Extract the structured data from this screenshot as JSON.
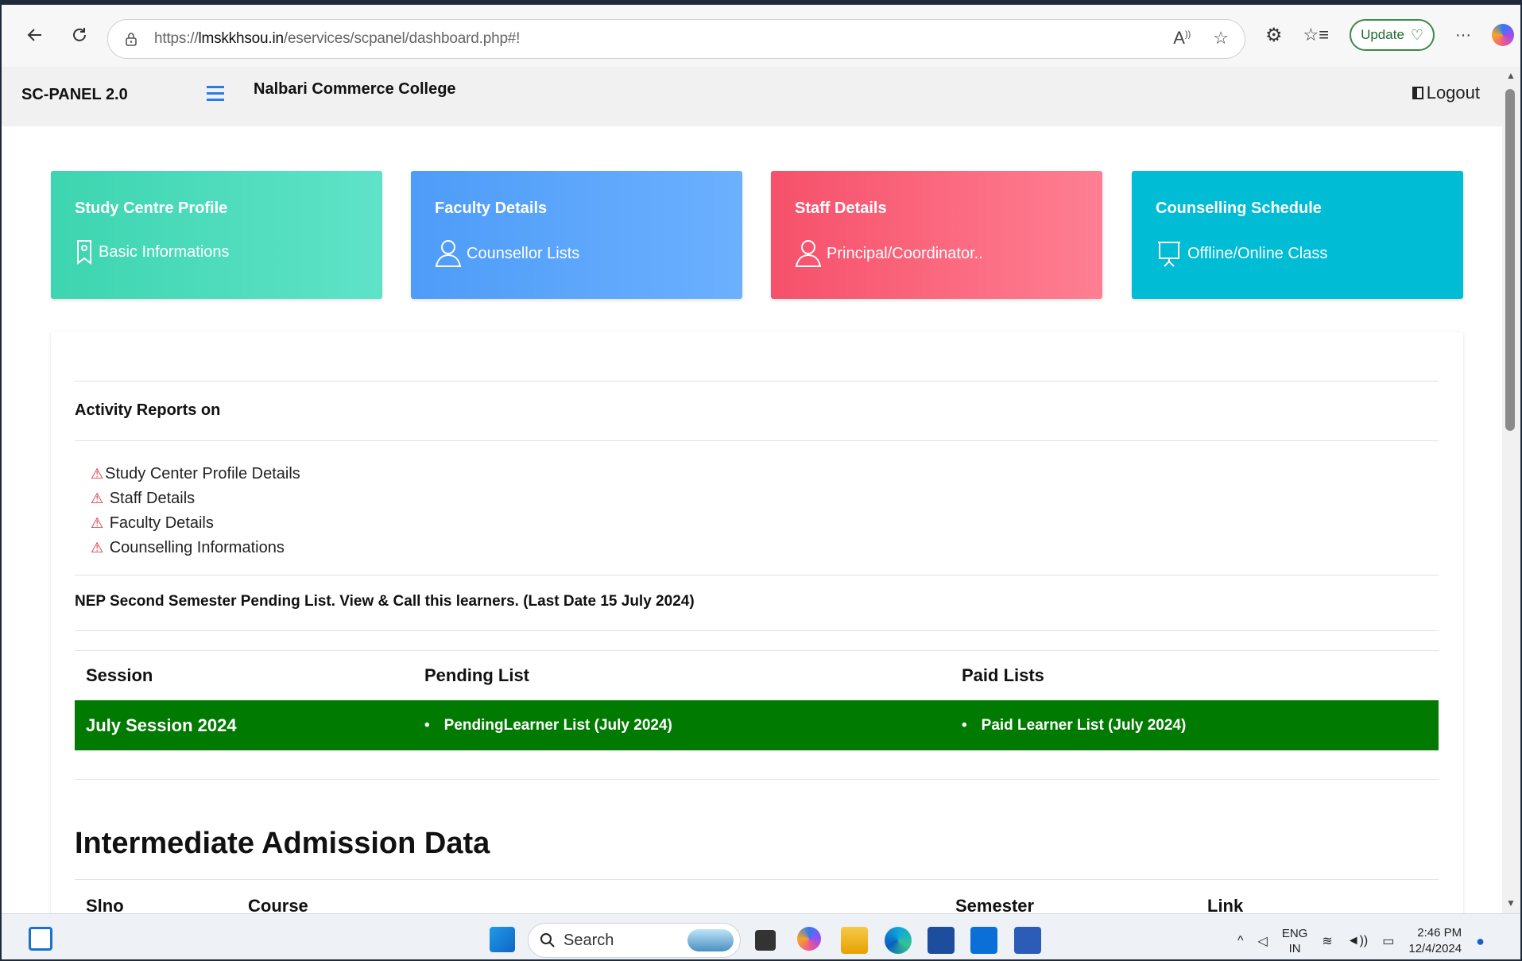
{
  "browser": {
    "url_prefix": "https://",
    "url_host": "lmskkhsou.in",
    "url_path": "/eservices/scpanel/dashboard.php#!",
    "update_label": "Update",
    "more_label": "···"
  },
  "header": {
    "brand": "SC-PANEL  2.0",
    "college": "Nalbari Commerce College",
    "logout_label": "Logout"
  },
  "tiles": [
    {
      "title": "Study Centre Profile",
      "subtitle": "Basic Informations",
      "icon": "bookmark-icon",
      "color": "#3dd5b0"
    },
    {
      "title": "Faculty Details",
      "subtitle": "Counsellor Lists",
      "icon": "user-icon",
      "color": "#4d9cf8"
    },
    {
      "title": "Staff Details",
      "subtitle": "Principal/Coordinator..",
      "icon": "user-icon",
      "color": "#f6506a"
    },
    {
      "title": "Counselling Schedule",
      "subtitle": "Offline/Online Class",
      "icon": "presentation-icon",
      "color": "#00bcd4"
    }
  ],
  "activity": {
    "title": "Activity Reports on",
    "items": [
      "Study Center Profile Details",
      " Staff Details",
      " Faculty Details",
      " Counselling Informations"
    ]
  },
  "nep": {
    "title": "NEP Second Semester Pending List. View & Call this learners. (Last Date 15 July 2024)",
    "headers": [
      "Session",
      "Pending List",
      "Paid Lists"
    ],
    "row": {
      "session": "July Session 2024",
      "pending": "PendingLearner List (July 2024)",
      "paid": "Paid Learner List (July 2024)"
    },
    "row_color": "#007a00"
  },
  "intermediate": {
    "title": "Intermediate Admission Data",
    "headers": [
      "Slno",
      "Course",
      "Semester",
      "Link"
    ]
  },
  "taskbar": {
    "search_label": "Search",
    "lang_top": "ENG",
    "lang_bottom": "IN",
    "time": "2:46 PM",
    "date": "12/4/2024"
  }
}
